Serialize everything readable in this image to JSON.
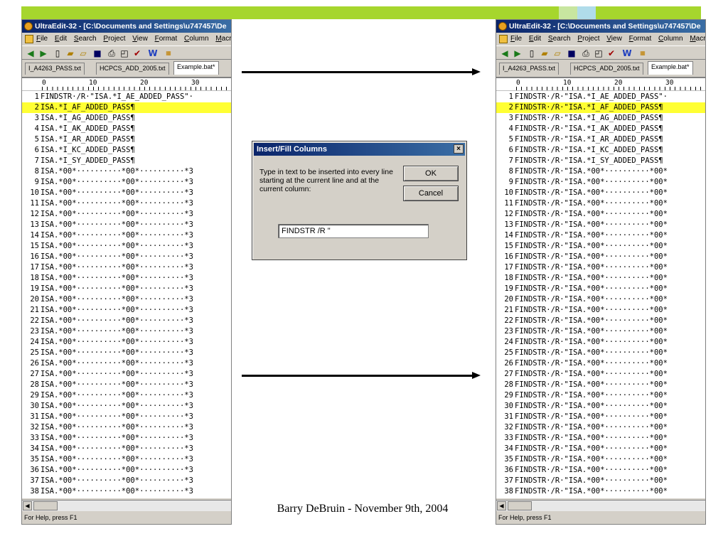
{
  "slide": {
    "caption": "Barry DeBruin - November 9th, 2004",
    "accent_color": "#a6d62d"
  },
  "editor_left": {
    "title": "UltraEdit-32 - [C:\\Documents and Settings\\u747457\\De",
    "menu": [
      "File",
      "Edit",
      "Search",
      "Project",
      "View",
      "Format",
      "Column",
      "Macro"
    ],
    "tabs": [
      "I_A4263_PASS.txt",
      "HCPCS_ADD_2005.txt",
      "Example.bat*"
    ],
    "active_tab": 2,
    "ruler": [
      "0",
      "10",
      "20",
      "30"
    ],
    "highlighted_line": 2,
    "lines": [
      "FINDSTR·/R·\"ISA.*I_AE_ADDED_PASS\"·",
      "ISA.*I_AF_ADDED_PASS¶",
      "ISA.*I_AG_ADDED_PASS¶",
      "ISA.*I_AK_ADDED_PASS¶",
      "ISA.*I_AR_ADDED_PASS¶",
      "ISA.*I_KC_ADDED_PASS¶",
      "ISA.*I_SY_ADDED_PASS¶",
      "ISA.*00*··········*00*··········*3",
      "ISA.*00*··········*00*··········*3",
      "ISA.*00*··········*00*··········*3",
      "ISA.*00*··········*00*··········*3",
      "ISA.*00*··········*00*··········*3",
      "ISA.*00*··········*00*··········*3",
      "ISA.*00*··········*00*··········*3",
      "ISA.*00*··········*00*··········*3",
      "ISA.*00*··········*00*··········*3",
      "ISA.*00*··········*00*··········*3",
      "ISA.*00*··········*00*··········*3",
      "ISA.*00*··········*00*··········*3",
      "ISA.*00*··········*00*··········*3",
      "ISA.*00*··········*00*··········*3",
      "ISA.*00*··········*00*··········*3",
      "ISA.*00*··········*00*··········*3",
      "ISA.*00*··········*00*··········*3",
      "ISA.*00*··········*00*··········*3",
      "ISA.*00*··········*00*··········*3",
      "ISA.*00*··········*00*··········*3",
      "ISA.*00*··········*00*··········*3",
      "ISA.*00*··········*00*··········*3",
      "ISA.*00*··········*00*··········*3",
      "ISA.*00*··········*00*··········*3",
      "ISA.*00*··········*00*··········*3",
      "ISA.*00*··········*00*··········*3",
      "ISA.*00*··········*00*··········*3",
      "ISA.*00*··········*00*··········*3",
      "ISA.*00*··········*00*··········*3",
      "ISA.*00*··········*00*··········*3",
      "ISA.*00*··········*00*··········*3"
    ],
    "status": "For Help, press F1"
  },
  "editor_right": {
    "title": "UltraEdit-32 - [C:\\Documents and Settings\\u747457\\De",
    "menu": [
      "File",
      "Edit",
      "Search",
      "Project",
      "View",
      "Format",
      "Column",
      "Macro"
    ],
    "tabs": [
      "I_A4263_PASS.txt",
      "HCPCS_ADD_2005.txt",
      "Example.bat*"
    ],
    "active_tab": 2,
    "ruler": [
      "0",
      "10",
      "20",
      "30"
    ],
    "highlighted_line": 2,
    "lines": [
      "FINDSTR·/R·\"ISA.*I_AE_ADDED_PASS\"·",
      "FINDSTR·/R·\"ISA.*I_AF_ADDED_PASS¶",
      "FINDSTR·/R·\"ISA.*I_AG_ADDED_PASS¶",
      "FINDSTR·/R·\"ISA.*I_AK_ADDED_PASS¶",
      "FINDSTR·/R·\"ISA.*I_AR_ADDED_PASS¶",
      "FINDSTR·/R·\"ISA.*I_KC_ADDED_PASS¶",
      "FINDSTR·/R·\"ISA.*I_SY_ADDED_PASS¶",
      "FINDSTR·/R·\"ISA.*00*··········*00*",
      "FINDSTR·/R·\"ISA.*00*··········*00*",
      "FINDSTR·/R·\"ISA.*00*··········*00*",
      "FINDSTR·/R·\"ISA.*00*··········*00*",
      "FINDSTR·/R·\"ISA.*00*··········*00*",
      "FINDSTR·/R·\"ISA.*00*··········*00*",
      "FINDSTR·/R·\"ISA.*00*··········*00*",
      "FINDSTR·/R·\"ISA.*00*··········*00*",
      "FINDSTR·/R·\"ISA.*00*··········*00*",
      "FINDSTR·/R·\"ISA.*00*··········*00*",
      "FINDSTR·/R·\"ISA.*00*··········*00*",
      "FINDSTR·/R·\"ISA.*00*··········*00*",
      "FINDSTR·/R·\"ISA.*00*··········*00*",
      "FINDSTR·/R·\"ISA.*00*··········*00*",
      "FINDSTR·/R·\"ISA.*00*··········*00*",
      "FINDSTR·/R·\"ISA.*00*··········*00*",
      "FINDSTR·/R·\"ISA.*00*··········*00*",
      "FINDSTR·/R·\"ISA.*00*··········*00*",
      "FINDSTR·/R·\"ISA.*00*··········*00*",
      "FINDSTR·/R·\"ISA.*00*··········*00*",
      "FINDSTR·/R·\"ISA.*00*··········*00*",
      "FINDSTR·/R·\"ISA.*00*··········*00*",
      "FINDSTR·/R·\"ISA.*00*··········*00*",
      "FINDSTR·/R·\"ISA.*00*··········*00*",
      "FINDSTR·/R·\"ISA.*00*··········*00*",
      "FINDSTR·/R·\"ISA.*00*··········*00*",
      "FINDSTR·/R·\"ISA.*00*··········*00*",
      "FINDSTR·/R·\"ISA.*00*··········*00*",
      "FINDSTR·/R·\"ISA.*00*··········*00*",
      "FINDSTR·/R·\"ISA.*00*··········*00*",
      "FINDSTR·/R·\"ISA.*00*··········*00*"
    ],
    "status": "For Help, press F1"
  },
  "dialog": {
    "title": "Insert/Fill Columns",
    "prompt": "Type in text to be inserted into every line starting at the current line and at the current column:",
    "ok_label": "OK",
    "cancel_label": "Cancel",
    "input_value": "FINDSTR /R \"",
    "close_glyph": "×"
  },
  "toolbar_icons": [
    "back-arrow-icon",
    "forward-arrow-icon",
    "new-file-icon",
    "open-folder-icon",
    "open-file-icon",
    "save-icon",
    "print-icon",
    "print-preview-icon",
    "spellcheck-icon",
    "word-wrap-icon",
    "hex-icon"
  ]
}
